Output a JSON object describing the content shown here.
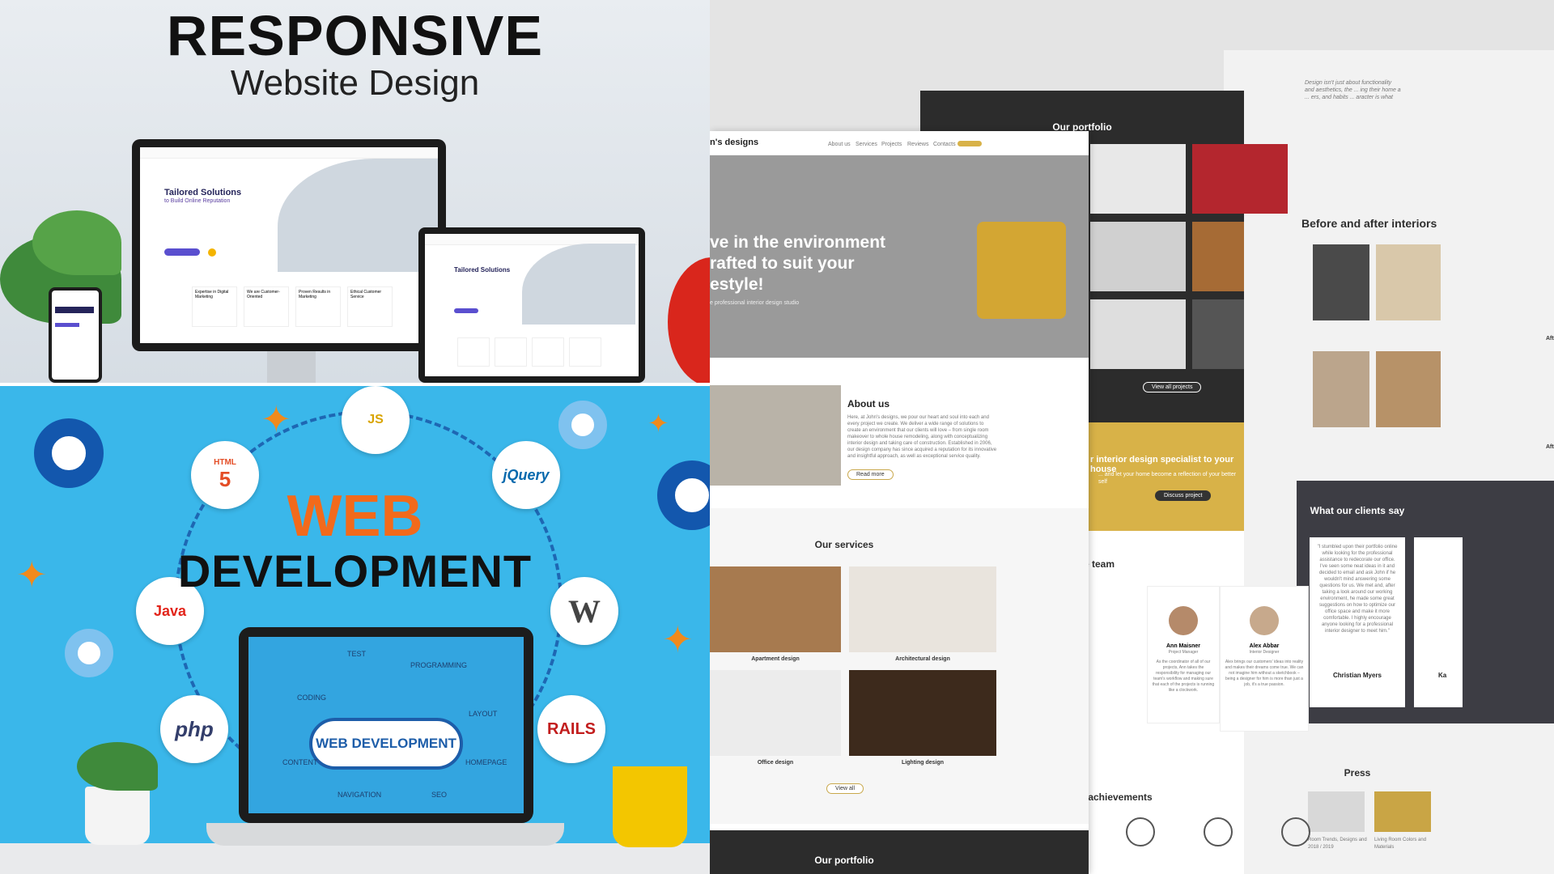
{
  "responsive": {
    "title": "RESPONSIVE",
    "subtitle": "Website Design",
    "mock_headline_1": "Tailored Solutions",
    "mock_headline_2": "to Build Online Reputation",
    "mock_cards": [
      "Expertise in Digital Marketing",
      "We are Customer-Oriented",
      "Proven Results in Marketing",
      "Ethical Customer Service"
    ]
  },
  "webdev": {
    "word_1": "WEB",
    "word_2": "DEVELOPMENT",
    "cloud_text": "WEB DEVELOPMENT",
    "badges": {
      "js": "JS",
      "html": "HTML",
      "html5": "5",
      "jquery": "jQuery",
      "java": "Java",
      "wordpress": "W",
      "php": "php",
      "rails": "RAILS"
    },
    "screen_labels": [
      "TEST",
      "PROGRAMMING",
      "CODING",
      "LAYOUT",
      "CONTENT",
      "HOMEPAGE",
      "NAVIGATION",
      "SEO"
    ]
  },
  "interior": {
    "brand": "n's designs",
    "nav": [
      "About us",
      "Services",
      "Projects",
      "Reviews",
      "Contacts"
    ],
    "hero_lines": [
      "ve in the environment",
      "rafted to suit your",
      "estyle!"
    ],
    "hero_sub": "e professional interior design studio",
    "about_title": "About us",
    "about_text": "Here, at John's designs, we pour our heart and soul into each and every project we create. We deliver a wide range of solutions to create an environment that our clients will love – from single room makeover to whole house remodeling, along with conceptualizing interior design and taking care of construction. Established in 2006, our design company has since acquired a reputation for its innovative and insightful approach, as well as exceptional service quality.",
    "read_more": "Read more",
    "services_title": "Our services",
    "services": [
      "Apartment design",
      "Architectural design",
      "Office design",
      "Lighting design"
    ],
    "view_all": "View all",
    "portfolio_title": "Our portfolio",
    "view_all_projects": "View all projects",
    "specialist": "r interior design specialist to your house",
    "specialist_sub": "... and let your home become a reflection of your better self",
    "discuss": "Discuss project",
    "team_title": "Meet the team",
    "team": [
      {
        "name": "Ann Maisner",
        "role": "Project Manager",
        "bio": "As the coordinator of all of our projects, Ann takes the responsibility for managing our team's workflow and making sure that each of the projects is running like a clockwork."
      },
      {
        "name": "Alex Abbar",
        "role": "Interior Designer",
        "bio": "Alex brings our customers' ideas into reality and makes their dreams come true. We can not imagine him without a sketchbook – being a designer for him is more than just a job, it's a true passion."
      }
    ],
    "awards_title": "Our awards and achievements",
    "portfolio_bottom": "Our portfolio",
    "quote_text": "Design isn't just about functionality and aesthetics, the ... ing their home a ... ers, and habits ... aracter is what",
    "before_after": "Before and after interiors",
    "after_label": "Afte",
    "clients_title": "What our clients say",
    "testimonial": "\"I stumbled upon their portfolio online while looking for the professional assistance to redecorate our office. I've seen some neat ideas in it and decided to email and ask John if he wouldn't mind answering some questions for us. We met and, after taking a look around our working environment, he made some great suggestions on how to optimize our office space and make it more comfortable. I highly encourage anyone looking for a professional interior designer to meet him.\"",
    "client_name": "Christian Myers",
    "client_name_2": "Ka",
    "press_title": "Press",
    "press_items": [
      "Room Trends, Designs and 2018 / 2019",
      "Living Room Colors and Materials"
    ]
  }
}
